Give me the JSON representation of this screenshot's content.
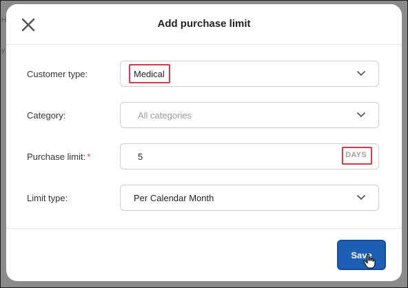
{
  "background": {
    "text_fragments": [
      "H",
      "y"
    ]
  },
  "modal": {
    "title": "Add purchase limit",
    "close_icon": "close-icon",
    "fields": {
      "customer_type": {
        "label": "Customer type:",
        "value": "Medical"
      },
      "category": {
        "label": "Category:",
        "placeholder": "All categories"
      },
      "purchase_limit": {
        "label": "Purchase limit:",
        "required_mark": "*",
        "value": "5",
        "unit": "DAYS"
      },
      "limit_type": {
        "label": "Limit type:",
        "value": "Per Calendar Month"
      }
    },
    "save_label": "Save"
  },
  "colors": {
    "primary": "#1d5fb4",
    "highlight": "#d9364a",
    "required": "#e0343b"
  }
}
